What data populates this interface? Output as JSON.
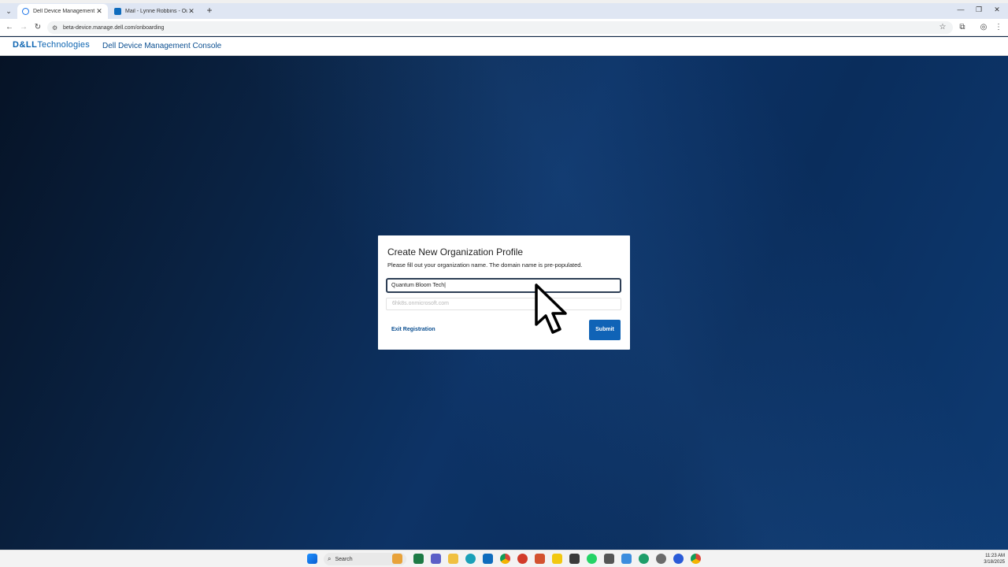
{
  "browser": {
    "tabs": [
      {
        "title": "Dell Device Management Cons",
        "active": true,
        "favicon_color": "#1a73e8"
      },
      {
        "title": "Mail - Lynne Robbins - Outlook",
        "active": false,
        "favicon_color": "#0f6cbd"
      }
    ],
    "url": "beta-device.manage.dell.com/onboarding"
  },
  "app": {
    "logo_brand": "D&LL",
    "logo_suffix": "Technologies",
    "title": "Dell Device Management Console"
  },
  "dialog": {
    "title": "Create New Organization Profile",
    "description": "Please fill out your organization name. The domain name is pre-populated.",
    "org_name_value": "Quantum Bloom Tech|",
    "domain_value": "6hk8s.onmicrosoft.com",
    "exit_label": "Exit Registration",
    "submit_label": "Submit"
  },
  "taskbar": {
    "search_label": "Search",
    "time": "11:23 AM",
    "date": "3/18/2025"
  },
  "colors": {
    "accent": "#1063b6",
    "brand_blue": "#0b4f91"
  }
}
